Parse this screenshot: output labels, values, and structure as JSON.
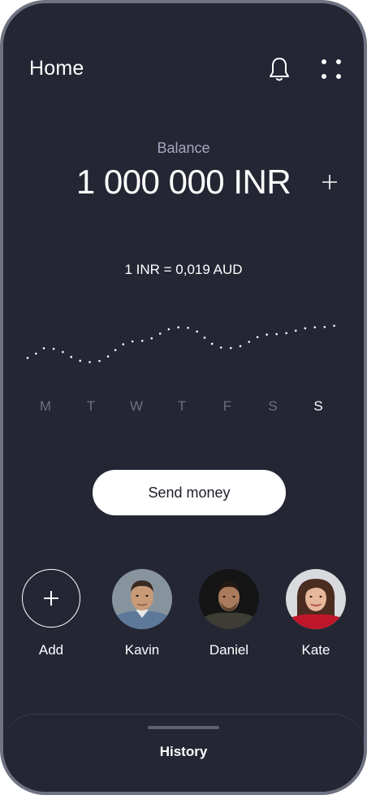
{
  "header": {
    "title": "Home",
    "notification_icon": "bell-icon",
    "menu_icon": "grid-dots-icon"
  },
  "balance": {
    "label": "Balance",
    "amount": "1 000 000 INR",
    "add_icon": "plus-icon"
  },
  "exchange": {
    "rate_text": "1 INR = 0,019 AUD",
    "days": [
      "M",
      "T",
      "W",
      "T",
      "F",
      "S",
      "S"
    ],
    "active_day_index": 6
  },
  "chart_data": {
    "type": "line",
    "categories": [
      "M",
      "T",
      "W",
      "T",
      "F",
      "S",
      "S"
    ],
    "series": [
      {
        "values": [
          0.0188,
          0.0186,
          0.0189,
          0.0191,
          0.0188,
          0.019,
          0.0191
        ]
      }
    ],
    "ylim": [
      0.0185,
      0.0192
    ],
    "grid": false,
    "line_style": "dotted"
  },
  "actions": {
    "send_label": "Send money"
  },
  "contacts": {
    "add_label": "Add",
    "people": [
      {
        "name": "Kavin"
      },
      {
        "name": "Daniel"
      },
      {
        "name": "Kate"
      }
    ]
  },
  "bottom": {
    "history_label": "History"
  },
  "colors": {
    "background": "#242634",
    "frame": "#6f7280",
    "muted": "#a5a8c0",
    "button": "#ffffff"
  }
}
